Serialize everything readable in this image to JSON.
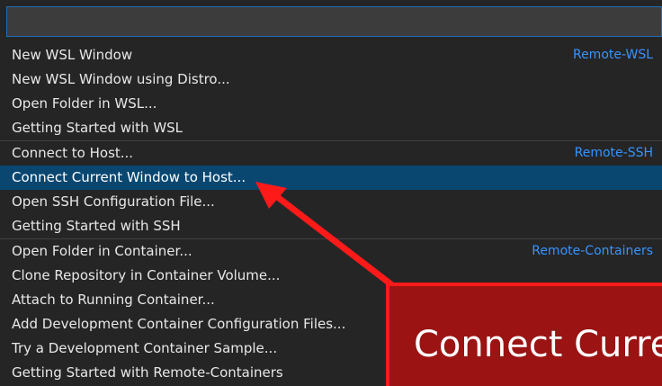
{
  "search": {
    "value": "",
    "placeholder": ""
  },
  "groups": [
    {
      "label": "Remote-WSL",
      "items": [
        "New WSL Window",
        "New WSL Window using Distro...",
        "Open Folder in WSL...",
        "Getting Started with WSL"
      ]
    },
    {
      "label": "Remote-SSH",
      "items": [
        "Connect to Host...",
        "Connect Current Window to Host...",
        "Open SSH Configuration File...",
        "Getting Started with SSH"
      ]
    },
    {
      "label": "Remote-Containers",
      "items": [
        "Open Folder in Container...",
        "Clone Repository in Container Volume...",
        "Attach to Running Container...",
        "Add Development Container Configuration Files...",
        "Try a Development Container Sample...",
        "Getting Started with Remote-Containers"
      ]
    }
  ],
  "selected_item": "Connect Current Window to Host...",
  "callout": {
    "text": "Connect Curre"
  },
  "colors": {
    "background": "#252526",
    "selection": "#094771",
    "group_label": "#3794ff",
    "annotation_red": "#ff1a1a",
    "callout_fill": "#9b1313"
  }
}
